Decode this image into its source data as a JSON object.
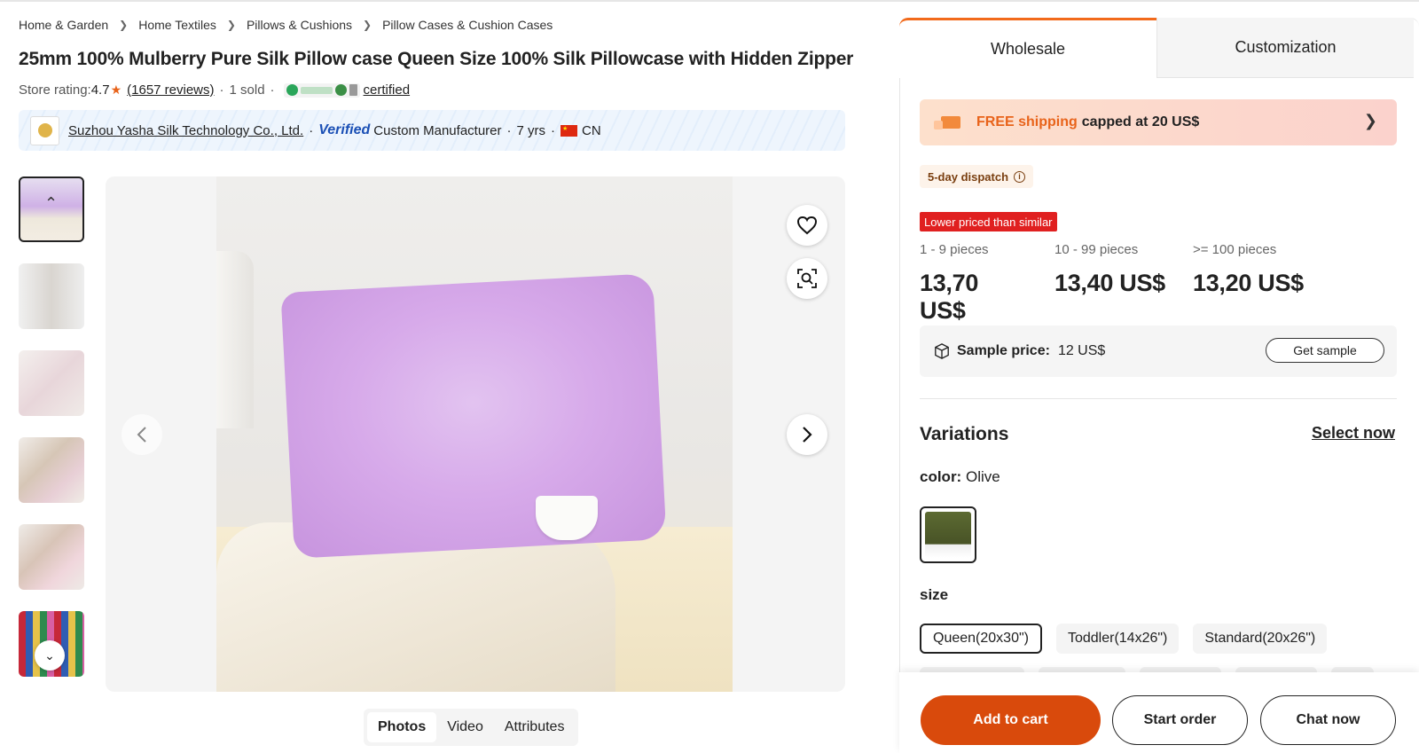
{
  "breadcrumb": [
    "Home & Garden",
    "Home Textiles",
    "Pillows & Cushions",
    "Pillow Cases & Cushion Cases"
  ],
  "product": {
    "title": "25mm 100% Mulberry Pure Silk Pillow case Queen Size 100% Silk Pillowcase with Hidden Zipper",
    "store_rating_label": "Store rating:",
    "store_rating": "4.7",
    "reviews": "(1657 reviews)",
    "sold": "1 sold",
    "certified": "certified"
  },
  "supplier": {
    "name": "Suzhou Yasha Silk Technology Co., Ltd.",
    "verified": "Verified",
    "type": "Custom Manufacturer",
    "years": "7 yrs",
    "country": "CN"
  },
  "gallery": {
    "thumbnail_count": 6,
    "active_index": 0,
    "tabs": [
      "Photos",
      "Video",
      "Attributes"
    ],
    "active_tab": "Photos"
  },
  "panel": {
    "tabs": [
      "Wholesale",
      "Customization"
    ],
    "active_tab": "Wholesale",
    "shipping": {
      "free": "FREE shipping",
      "rest": "capped at 20 US$"
    },
    "dispatch": "5-day dispatch",
    "lower_badge": "Lower priced than similar",
    "tiers": [
      {
        "qty": "1 - 9 pieces",
        "price": "13,70 US$"
      },
      {
        "qty": "10 - 99 pieces",
        "price": "13,40 US$"
      },
      {
        "qty": ">= 100 pieces",
        "price": "13,20 US$"
      }
    ],
    "sample": {
      "label": "Sample price:",
      "price": "12 US$",
      "button": "Get sample"
    },
    "variations": {
      "title": "Variations",
      "select_now": "Select now",
      "color_label": "color:",
      "color_value": "Olive",
      "size_label": "size",
      "sizes": [
        "Queen(20x30\")",
        "Toddler(14x26\")",
        "Standard(20x26\")"
      ],
      "selected_size": 0
    },
    "actions": {
      "add_to_cart": "Add to cart",
      "start_order": "Start order",
      "chat_now": "Chat now"
    }
  },
  "colors": {
    "accent": "#e8631a",
    "cart_button": "#d94a0c",
    "badge_red": "#e02020"
  }
}
